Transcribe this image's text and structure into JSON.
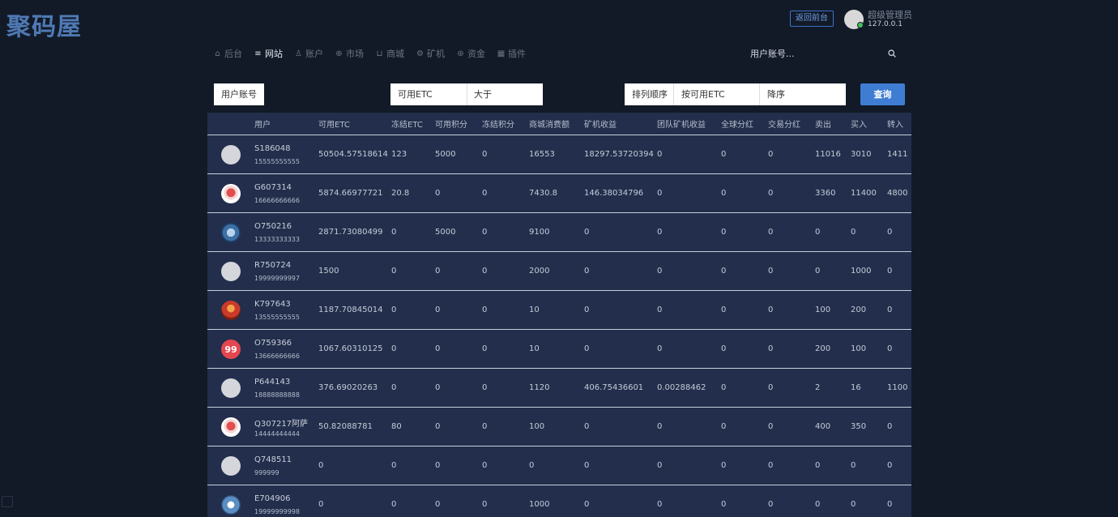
{
  "logo": "聚码屋",
  "header": {
    "front_button": "返回前台",
    "admin_name": "超级管理员",
    "admin_ip": "127.0.0.1"
  },
  "nav": [
    {
      "label": "后台",
      "icon": "home-icon"
    },
    {
      "label": "网站",
      "icon": "list-icon",
      "active": true
    },
    {
      "label": "账户",
      "icon": "users-icon"
    },
    {
      "label": "市场",
      "icon": "globe-icon"
    },
    {
      "label": "商城",
      "icon": "cart-icon"
    },
    {
      "label": "矿机",
      "icon": "gear-icon"
    },
    {
      "label": "资金",
      "icon": "coin-icon"
    },
    {
      "label": "插件",
      "icon": "grid-icon"
    }
  ],
  "search": {
    "label": "用户账号..."
  },
  "filters": {
    "user_account": "用户账号",
    "field": "可用ETC",
    "operator": "大于",
    "sort_label": "排列顺序",
    "sort_by": "按可用ETC",
    "sort_dir": "降序",
    "query_button": "查询"
  },
  "table": {
    "headers": [
      "用户",
      "可用ETC",
      "冻结ETC",
      "可用积分",
      "冻结积分",
      "商城消费额",
      "矿机收益",
      "团队矿机收益",
      "全球分红",
      "交易分红",
      "卖出",
      "买入",
      "转入"
    ],
    "rows": [
      {
        "user": "S186048",
        "phone": "15555555555",
        "vals": [
          "50504.57518614",
          "123",
          "5000",
          "0",
          "16553",
          "18297.53720394",
          "0",
          "0",
          "0",
          "11016",
          "3010",
          "1411"
        ]
      },
      {
        "user": "G607314",
        "phone": "16666666666",
        "vals": [
          "5874.66977721",
          "20.8",
          "0",
          "0",
          "7430.8",
          "146.38034796",
          "0",
          "0",
          "0",
          "3360",
          "11400",
          "4800"
        ]
      },
      {
        "user": "O750216",
        "phone": "13333333333",
        "vals": [
          "2871.73080499",
          "0",
          "5000",
          "0",
          "9100",
          "0",
          "0",
          "0",
          "0",
          "0",
          "0",
          "0"
        ]
      },
      {
        "user": "R750724",
        "phone": "19999999997",
        "vals": [
          "1500",
          "0",
          "0",
          "0",
          "2000",
          "0",
          "0",
          "0",
          "0",
          "0",
          "1000",
          "0"
        ]
      },
      {
        "user": "K797643",
        "phone": "13555555555",
        "vals": [
          "1187.70845014",
          "0",
          "0",
          "0",
          "10",
          "0",
          "0",
          "0",
          "0",
          "100",
          "200",
          "0"
        ]
      },
      {
        "user": "O759366",
        "phone": "13666666666",
        "vals": [
          "1067.60310125",
          "0",
          "0",
          "0",
          "10",
          "0",
          "0",
          "0",
          "0",
          "200",
          "100",
          "0"
        ]
      },
      {
        "user": "P644143",
        "phone": "18888888888",
        "vals": [
          "376.69020263",
          "0",
          "0",
          "0",
          "1120",
          "406.75436601",
          "0.00288462",
          "0",
          "0",
          "2",
          "16",
          "1100"
        ]
      },
      {
        "user": "Q307217阿萨",
        "phone": "14444444444",
        "vals": [
          "50.82088781",
          "80",
          "0",
          "0",
          "100",
          "0",
          "0",
          "0",
          "0",
          "400",
          "350",
          "0"
        ]
      },
      {
        "user": "Q748511",
        "phone": "999999",
        "vals": [
          "0",
          "0",
          "0",
          "0",
          "0",
          "0",
          "0",
          "0",
          "0",
          "0",
          "0",
          "0"
        ]
      },
      {
        "user": "E704906",
        "phone": "19999999998",
        "vals": [
          "0",
          "0",
          "0",
          "0",
          "1000",
          "0",
          "0",
          "0",
          "0",
          "0",
          "0",
          "0"
        ]
      }
    ]
  },
  "avatar_badge_text": "99"
}
